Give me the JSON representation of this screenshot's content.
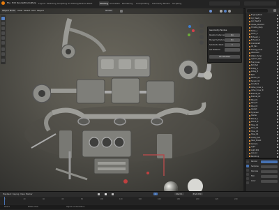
{
  "topbar": {
    "menus": [
      "File",
      "Edit",
      "Render",
      "Window",
      "Help"
    ],
    "workspaces": [
      "Layout",
      "Modeling",
      "Sculpting",
      "UV Editing",
      "Texture Paint",
      "Shading",
      "Animation",
      "Rendering",
      "Compositing",
      "Geometry Nodes",
      "Scripting"
    ],
    "active_workspace": "Shading"
  },
  "viewport": {
    "header_items": [
      "Object Mode",
      "View",
      "Select",
      "Add",
      "Object"
    ],
    "scene_label": "Global",
    "overlay_panel": {
      "title": "Geometry Nodes",
      "rows": [
        {
          "label": "Realize Instances",
          "value": "On"
        },
        {
          "label": "Merge By Distance",
          "value": "On"
        },
        {
          "label": "Subdivide Mesh",
          "value": "1"
        },
        {
          "label": "Set Material",
          "value": ""
        }
      ],
      "button_label": "Add Modifier"
    }
  },
  "outliner": {
    "rows": [
      "Engine_Block",
      "Cyl_Head_L",
      "Cyl_Head_R",
      "Intake_Manifold",
      "Throttle_Body",
      "Turbo_L",
      "Turbo_R",
      "Exhaust_L",
      "Exhaust_R",
      "Crankshaft",
      "Oil_Pan",
      "Timing_Cover",
      "Alternator",
      "Water_Pump",
      "Injector_Rail",
      "Fuel_Lines",
      "Bolt_Set",
      "Pulley_A",
      "Pulley_B",
      "Belt",
      "Sensor_01",
      "Sensor_02",
      "Coil_Pack",
      "Valve_Cover_L",
      "Valve_Cover_R",
      "Bracket_01",
      "Bracket_02",
      "Pipe_01",
      "Pipe_02",
      "Pipe_03",
      "Gasket",
      "Flywheel",
      "Starter",
      "Mount_L",
      "Mount_R",
      "Hose_01",
      "Hose_02",
      "Hose_03",
      "Hose_04",
      "Clamp_Set",
      "Heat_Shield",
      "Camera",
      "Light",
      "Light.001",
      "Ground",
      "Backdrop"
    ]
  },
  "properties": {
    "rows": [
      "Render",
      "Samples",
      "Denoise",
      "Film",
      "Color"
    ]
  },
  "timeline": {
    "items": [
      "Playback",
      "Keying",
      "View",
      "Marker"
    ],
    "frame_current": "1",
    "frame_start": "Start 1",
    "frame_end": "End 250",
    "ticks": [
      "0",
      "20",
      "40",
      "60",
      "80",
      "100",
      "120",
      "140",
      "160",
      "180",
      "200",
      "220",
      "240"
    ]
  },
  "status": {
    "left": "Select",
    "mid": "Rotate View",
    "right": "Object Context Menu"
  },
  "colors": {
    "accent": "#4772b3",
    "active_tool": "#5680c2",
    "object_icon": "#e8953a"
  }
}
